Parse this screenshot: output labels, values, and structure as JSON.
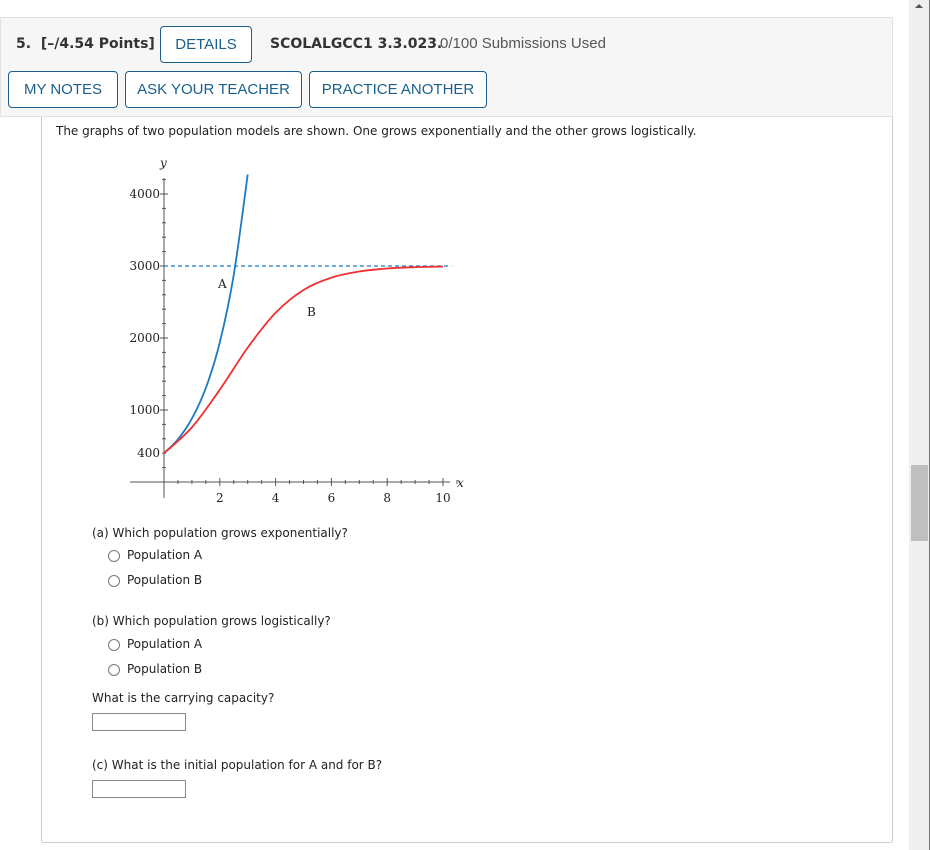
{
  "header": {
    "question_number": "5.",
    "points": "[–/4.54 Points]",
    "details_label": "DETAILS",
    "code": "SCOLALGCC1 3.3.023.",
    "submissions": "0/100 Submissions Used",
    "my_notes_label": "MY NOTES",
    "ask_teacher_label": "ASK YOUR TEACHER",
    "practice_label": "PRACTICE ANOTHER"
  },
  "question": {
    "intro": "The graphs of two population models are shown. One grows exponentially and the other grows logistically.",
    "part_a": {
      "prompt": "(a) Which population grows exponentially?",
      "options": [
        "Population A",
        "Population B"
      ]
    },
    "part_b": {
      "prompt": "(b) Which population grows logistically?",
      "options": [
        "Population A",
        "Population B"
      ],
      "followup": "What is the carrying capacity?",
      "answer": ""
    },
    "part_c": {
      "prompt": "(c) What is the initial population for A and for B?",
      "answer": ""
    }
  },
  "chart_data": {
    "type": "line",
    "xlabel": "x",
    "ylabel": "y",
    "xlim": [
      0,
      10
    ],
    "ylim": [
      0,
      4200
    ],
    "x_ticks": [
      "2",
      "4",
      "6",
      "8",
      "10"
    ],
    "y_ticks": [
      "400",
      "1000",
      "2000",
      "3000",
      "4000"
    ],
    "grid": false,
    "series": [
      {
        "name": "A",
        "color": "#1a7bc4",
        "x": [
          0,
          0.5,
          1,
          1.5,
          2,
          2.5,
          3
        ],
        "y": [
          400,
          593,
          881,
          1306,
          1939,
          2877,
          4270
        ]
      },
      {
        "name": "B",
        "color": "#f03030",
        "x": [
          0,
          1,
          2,
          3,
          4,
          5,
          6,
          7,
          8,
          9,
          10
        ],
        "y": [
          400,
          759,
          1282,
          1866,
          2351,
          2667,
          2839,
          2924,
          2965,
          2984,
          2993
        ]
      }
    ],
    "asymptote": {
      "y": 3000,
      "style": "dashed",
      "color": "#1a7bc4"
    }
  },
  "colors": {
    "accent": "#1b5f8c",
    "header_bg": "#f6f6f6"
  }
}
